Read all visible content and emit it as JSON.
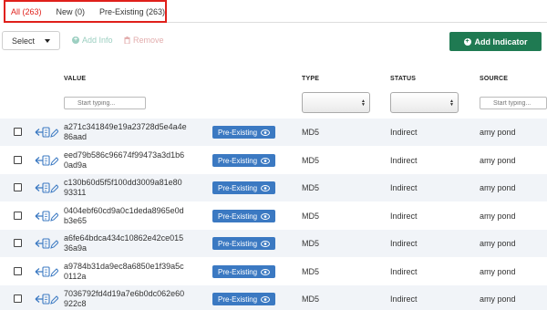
{
  "tabs": [
    {
      "label": "All (263)",
      "active": true
    },
    {
      "label": "New (0)",
      "active": false
    },
    {
      "label": "Pre-Existing (263)",
      "active": false
    }
  ],
  "toolbar": {
    "select_label": "Select",
    "add_info_label": "Add Info",
    "remove_label": "Remove",
    "add_indicator_label": "Add Indicator"
  },
  "columns": {
    "value": "VALUE",
    "type": "TYPE",
    "status": "STATUS",
    "source": "SOURCE"
  },
  "filters": {
    "value_placeholder": "Start typing...",
    "source_placeholder": "Start typing..."
  },
  "rows": [
    {
      "value_line1": "a271c341849e19a23728d5e4a4e",
      "value_line2": "86aad",
      "badge": "Pre-Existing",
      "type": "MD5",
      "status": "Indirect",
      "source": "amy pond"
    },
    {
      "value_line1": "eed79b586c96674f99473a3d1b6",
      "value_line2": "0ad9a",
      "badge": "Pre-Existing",
      "type": "MD5",
      "status": "Indirect",
      "source": "amy pond"
    },
    {
      "value_line1": "c130b60d5f5f100dd3009a81e80",
      "value_line2": "93311",
      "badge": "Pre-Existing",
      "type": "MD5",
      "status": "Indirect",
      "source": "amy pond"
    },
    {
      "value_line1": "0404ebf60cd9a0c1deda8965e0d",
      "value_line2": "b3e65",
      "badge": "Pre-Existing",
      "type": "MD5",
      "status": "Indirect",
      "source": "amy pond"
    },
    {
      "value_line1": "a6fe64bdca434c10862e42ce015",
      "value_line2": "36a9a",
      "badge": "Pre-Existing",
      "type": "MD5",
      "status": "Indirect",
      "source": "amy pond"
    },
    {
      "value_line1": "a9784b31da9ec8a6850e1f39a5c",
      "value_line2": "0112a",
      "badge": "Pre-Existing",
      "type": "MD5",
      "status": "Indirect",
      "source": "amy pond"
    },
    {
      "value_line1": "7036792fd4d19a7e6b0dc062e60",
      "value_line2": "922c8",
      "badge": "Pre-Existing",
      "type": "MD5",
      "status": "Indirect",
      "source": "amy pond"
    }
  ],
  "icons": {
    "tool_icon": "restore-document-icon",
    "edit_icon": "pencil-icon",
    "badge_icon": "eye-icon"
  },
  "colors": {
    "active_tab": "#e0201b",
    "primary_button": "#1f7a52",
    "badge": "#3b79c2",
    "row_alt": "#f1f4f8"
  }
}
